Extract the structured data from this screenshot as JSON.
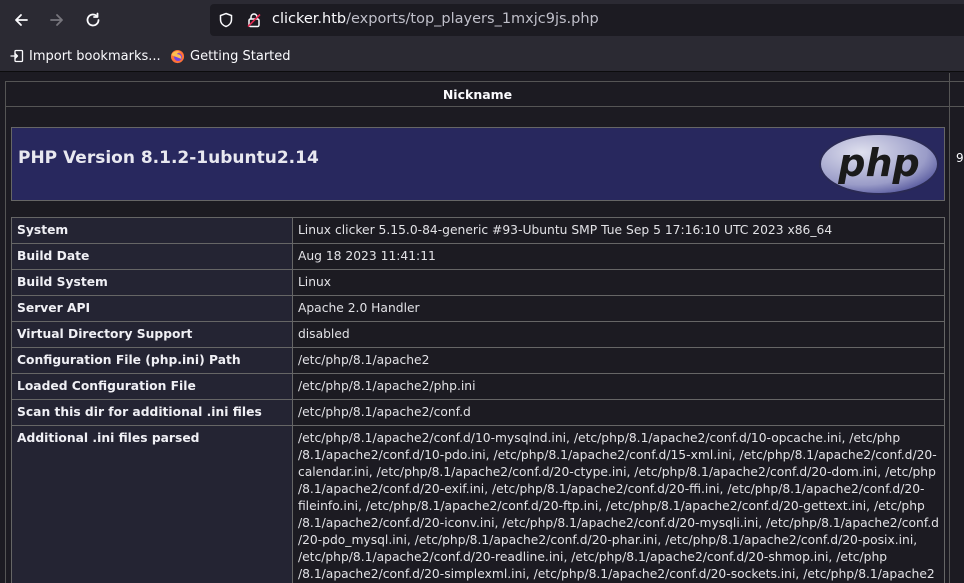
{
  "browser": {
    "url_host": "clicker.htb",
    "url_path": "/exports/top_players_1mxjc9js.php",
    "bookmarks": [
      {
        "label": "Import bookmarks...",
        "icon": "import-icon"
      },
      {
        "label": "Getting Started",
        "icon": "firefox-icon"
      }
    ]
  },
  "page": {
    "column_header": "Nickname",
    "side_value": "9",
    "php_title": "PHP Version 8.1.2-1ubuntu2.14",
    "logo_text": "php",
    "rows": [
      {
        "key": "System",
        "value": "Linux clicker 5.15.0-84-generic #93-Ubuntu SMP Tue Sep 5 17:16:10 UTC 2023 x86_64"
      },
      {
        "key": "Build Date",
        "value": "Aug 18 2023 11:41:11"
      },
      {
        "key": "Build System",
        "value": "Linux"
      },
      {
        "key": "Server API",
        "value": "Apache 2.0 Handler"
      },
      {
        "key": "Virtual Directory Support",
        "value": "disabled"
      },
      {
        "key": "Configuration File (php.ini) Path",
        "value": "/etc/php/8.1/apache2"
      },
      {
        "key": "Loaded Configuration File",
        "value": "/etc/php/8.1/apache2/php.ini"
      },
      {
        "key": "Scan this dir for additional .ini files",
        "value": "/etc/php/8.1/apache2/conf.d"
      },
      {
        "key": "Additional .ini files parsed",
        "value_lines": [
          "/etc/php/8.1/apache2/conf.d/10-mysqlnd.ini, /etc/php/8.1/apache2/conf.d/10-opcache.ini, /etc/php",
          "/8.1/apache2/conf.d/10-pdo.ini, /etc/php/8.1/apache2/conf.d/15-xml.ini, /etc/php/8.1/apache2/conf.d/20-",
          "calendar.ini, /etc/php/8.1/apache2/conf.d/20-ctype.ini, /etc/php/8.1/apache2/conf.d/20-dom.ini, /etc/php",
          "/8.1/apache2/conf.d/20-exif.ini, /etc/php/8.1/apache2/conf.d/20-ffi.ini, /etc/php/8.1/apache2/conf.d/20-",
          "fileinfo.ini, /etc/php/8.1/apache2/conf.d/20-ftp.ini, /etc/php/8.1/apache2/conf.d/20-gettext.ini, /etc/php",
          "/8.1/apache2/conf.d/20-iconv.ini, /etc/php/8.1/apache2/conf.d/20-mysqli.ini, /etc/php/8.1/apache2/conf.d",
          "/20-pdo_mysql.ini, /etc/php/8.1/apache2/conf.d/20-phar.ini, /etc/php/8.1/apache2/conf.d/20-posix.ini,",
          "/etc/php/8.1/apache2/conf.d/20-readline.ini, /etc/php/8.1/apache2/conf.d/20-shmop.ini, /etc/php",
          "/8.1/apache2/conf.d/20-simplexml.ini, /etc/php/8.1/apache2/conf.d/20-sockets.ini, /etc/php/8.1/apache2"
        ]
      }
    ]
  }
}
